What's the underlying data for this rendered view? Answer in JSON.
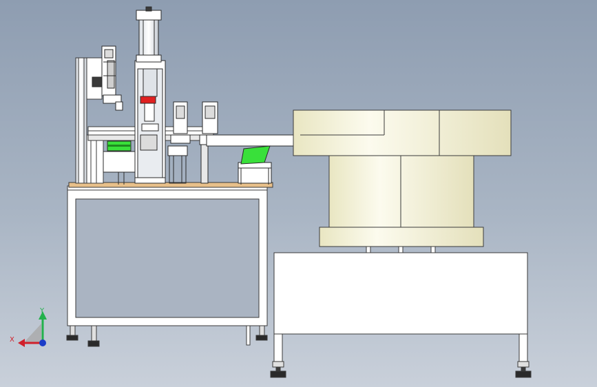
{
  "viewport": {
    "background_top": "#8e9db1",
    "background_bottom": "#c9d0da"
  },
  "triad": {
    "x_label": "X",
    "y_label": "Y",
    "x_color": "#d0202a",
    "y_color": "#22b14c",
    "z_color": "#1a3cc8"
  },
  "model": {
    "frame_color": "#ffffff",
    "outline_color": "#3a3a3a",
    "bowl_color": "#f4f1d6",
    "tray_color": "#39e03a",
    "plate_color": "#e8c08a",
    "accent_red": "#e02020"
  }
}
